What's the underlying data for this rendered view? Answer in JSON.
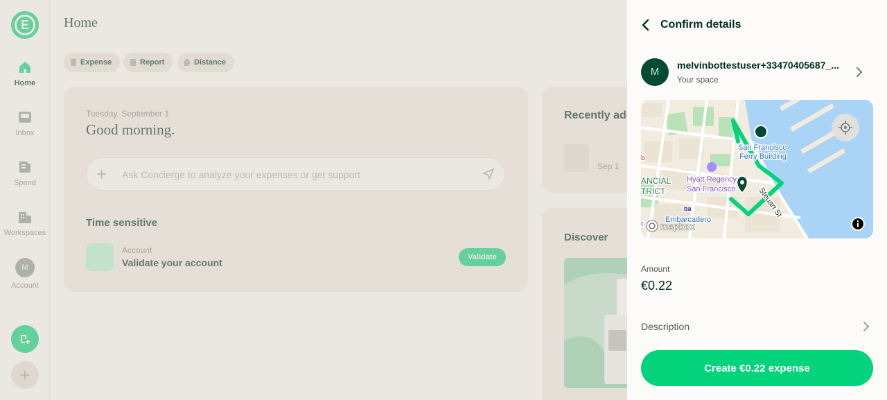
{
  "sidebar": {
    "logo_letter": "E",
    "items": [
      {
        "label": "Home",
        "icon": "home-icon"
      },
      {
        "label": "Inbox",
        "icon": "inbox-icon"
      },
      {
        "label": "Spend",
        "icon": "receipt-icon"
      },
      {
        "label": "Workspaces",
        "icon": "building-icon"
      },
      {
        "label": "Account",
        "avatar": "M"
      }
    ],
    "fab_plus": "+"
  },
  "home": {
    "title": "Home",
    "chips": [
      {
        "label": "Expense"
      },
      {
        "label": "Report"
      },
      {
        "label": "Distance"
      }
    ],
    "date": "Tuesday, September 1",
    "greeting": "Good morning.",
    "concierge_placeholder": "Ask Concierge to analyze your expenses or get support",
    "concierge_plus": "+",
    "time_sensitive_heading": "Time sensitive",
    "task": {
      "label": "Account",
      "title": "Validate your account",
      "button": "Validate"
    },
    "recently_heading": "Recently ade",
    "recent_date": "Sep 1",
    "discover_heading": "Discover"
  },
  "panel": {
    "title": "Confirm details",
    "space": {
      "avatar": "M",
      "name": "melvinbottestuser+33470405687_...",
      "subtitle": "Your space"
    },
    "map": {
      "labels": {
        "ferry1": "San Francisco",
        "ferry2": "Ferry Building",
        "hyatt1": "Hyatt Regency",
        "hyatt2": "San Francisco",
        "financial1": "ANCIAL",
        "financial2": "TRICT",
        "steuart": "Steuart St",
        "embarcadero": "Embarcadero",
        "bart": "ba",
        "edge_b": "b",
        "edge_t": "t"
      },
      "attribution": "mapbox",
      "route_color": "#03d47c"
    },
    "amount_label": "Amount",
    "amount_value": "€0.22",
    "description_label": "Description",
    "create_button": "Create €0.22 expense"
  },
  "colors": {
    "brand": "#03d47c",
    "dark": "#002e22"
  }
}
